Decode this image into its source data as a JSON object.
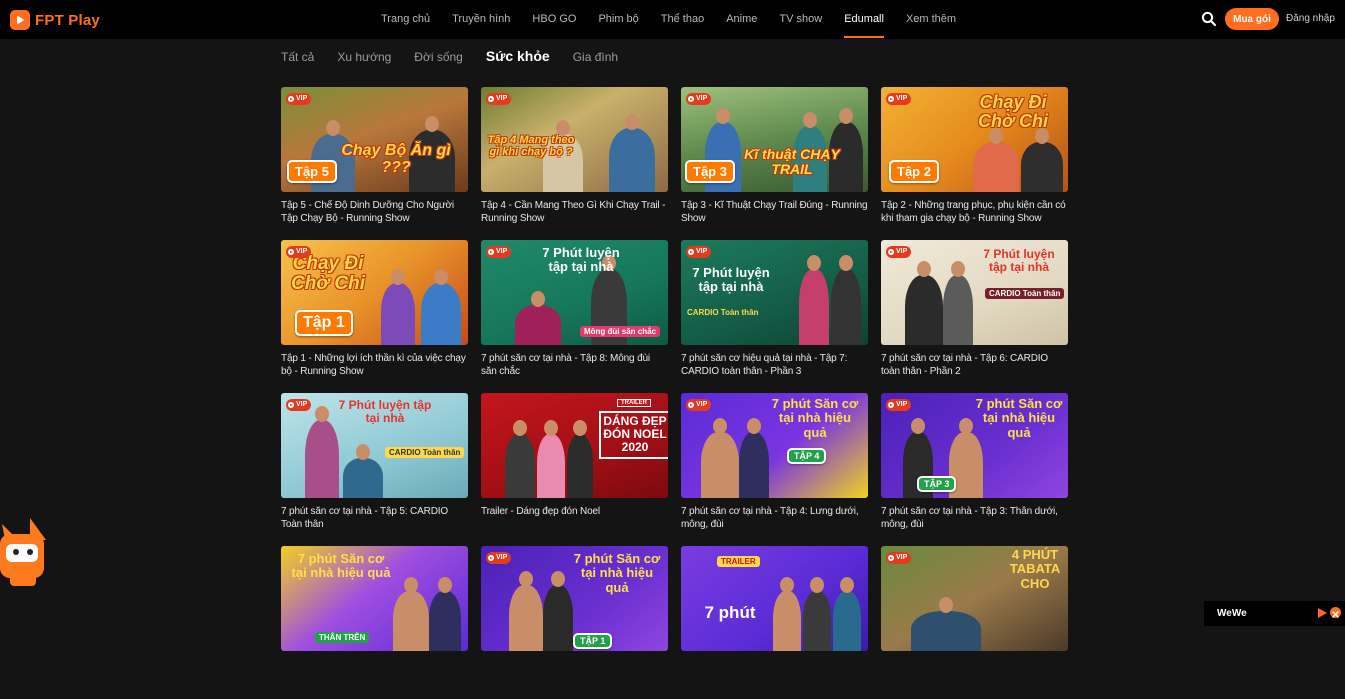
{
  "app": {
    "logo_text": "FPT Play"
  },
  "nav": {
    "items": [
      {
        "label": "Trang chủ",
        "active": false
      },
      {
        "label": "Truyền hình",
        "active": false
      },
      {
        "label": "HBO GO",
        "active": false
      },
      {
        "label": "Phim bộ",
        "active": false
      },
      {
        "label": "Thể thao",
        "active": false
      },
      {
        "label": "Anime",
        "active": false
      },
      {
        "label": "TV show",
        "active": false
      },
      {
        "label": "Edumall",
        "active": true
      },
      {
        "label": "Xem thêm",
        "active": false
      }
    ],
    "buy_label": "Mua gói",
    "login_label": "Đăng nhập"
  },
  "categories": [
    {
      "label": "Tất cả",
      "active": false
    },
    {
      "label": "Xu hướng",
      "active": false
    },
    {
      "label": "Đời sống",
      "active": false
    },
    {
      "label": "Sức khỏe",
      "active": true
    },
    {
      "label": "Gia đình",
      "active": false
    }
  ],
  "vip_label": "VIP",
  "cards": [
    {
      "title": "Tập 5 - Chế Độ Dinh Dưỡng Cho Người Tập Chạy Bộ - Running Show",
      "badge": "Tập 5",
      "headline": "Chạy Bộ Ăn gì ???",
      "vip": true
    },
    {
      "title": "Tập 4 - Cần Mang Theo Gì Khi Chạy Trail - Running Show",
      "badge": "",
      "headline": "Tập 4 Mang theo gì khi chạy bộ ?",
      "vip": true
    },
    {
      "title": "Tập 3 - Kĩ Thuật Chạy Trail Đúng - Running Show",
      "badge": "Tập 3",
      "headline": "Kĩ thuật CHẠY TRAIL",
      "vip": true
    },
    {
      "title": "Tập 2 - Những trang phục, phụ kiện cần có khi tham gia chạy bộ - Running Show",
      "badge": "Tập 2",
      "headline": "Chạy Đi Chờ Chi",
      "vip": true
    },
    {
      "title": "Tập 1 - Những lợi ích thần kì của việc chạy bộ - Running Show",
      "badge": "Tập 1",
      "headline": "Chạy Đi Chờ Chi",
      "vip": true
    },
    {
      "title": "7 phút săn cơ tại nhà - Tập 8: Mông đùi săn chắc",
      "badge": "",
      "headline": "7 Phút luyện tập tại nhà",
      "caption": "Mông đùi săn chắc",
      "vip": true
    },
    {
      "title": "7 phút săn cơ hiệu quả tại nhà - Tập 7: CARDIO toàn thân - Phần 3",
      "badge": "",
      "headline": "7 Phút luyện tập tại nhà",
      "caption": "CARDIO Toàn thân",
      "vip": true
    },
    {
      "title": "7 phút săn cơ tại nhà - Tập 6: CARDIO toàn thân - Phần 2",
      "badge": "",
      "headline": "7 Phút luyện tập tại nhà",
      "caption": "CARDIO Toàn thân",
      "vip": true
    },
    {
      "title": "7 phút săn cơ tại nhà - Tập 5: CARDIO Toàn thân",
      "badge": "",
      "headline": "7 Phút luyện tập tại nhà",
      "caption": "CARDIO Toàn thân",
      "vip": true
    },
    {
      "title": "Trailer - Dáng đẹp đón Noel",
      "badge": "",
      "headline": "DÁNG ĐẸP ĐÓN NOEL 2020",
      "caption": "TRAILER",
      "vip": false
    },
    {
      "title": "7 phút săn cơ tại nhà - Tập 4: Lưng dưới, mông, đùi",
      "badge": "TẬP 4",
      "headline": "7 phút Săn cơ tại nhà hiệu quả",
      "vip": true
    },
    {
      "title": "7 phút săn cơ tại nhà - Tập 3: Thân dưới, mông, đùi",
      "badge": "TẬP 3",
      "headline": "7 phút Săn cơ tại nhà hiệu quả",
      "vip": true
    },
    {
      "title": "",
      "badge": "",
      "headline": "7 phút Săn cơ tại nhà hiệu quả",
      "caption": "THÂN TRÊN",
      "vip": false
    },
    {
      "title": "",
      "badge": "TẬP 1",
      "headline": "7 phút Săn cơ tại nhà hiệu quả",
      "vip": true
    },
    {
      "title": "",
      "badge": "",
      "headline": "7 phút",
      "caption": "TRAILER",
      "vip": false
    },
    {
      "title": "",
      "badge": "",
      "headline": "4 PHÚT TABATA CHO",
      "vip": true
    }
  ],
  "mini_player": {
    "title": "WeWe"
  },
  "colors": {
    "accent": "#ff6d1f",
    "background": "#141414",
    "topbar": "#000000"
  }
}
